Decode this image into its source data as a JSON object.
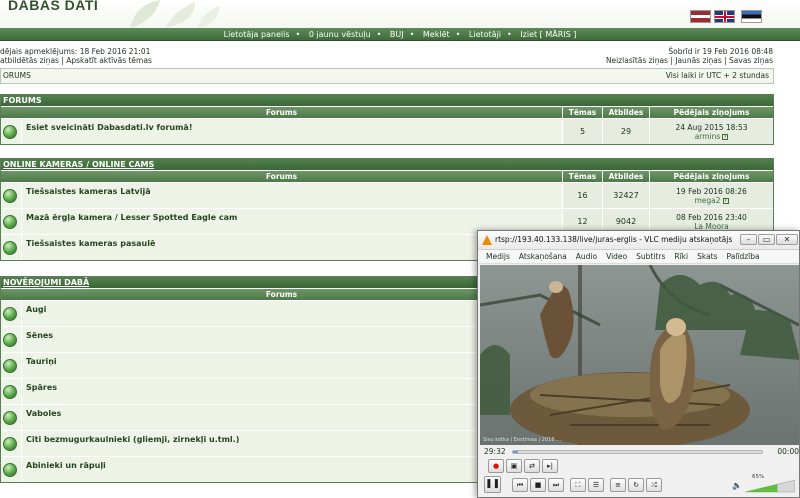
{
  "site": {
    "logo": "DABAS DATI"
  },
  "navbar": {
    "items": [
      "Lietotāja panelis",
      "0 jaunu vēstuļu",
      "BUJ",
      "Meklēt",
      "Lietotāji",
      "Iziet [ MĀRIS ]"
    ],
    "sep": "•"
  },
  "info": {
    "last_visit": "dējais apmeklējums: 18 Feb 2016 21:01",
    "left_links": "atbildētās ziņas | Apskatīt aktīvās tēmas",
    "today": "Šobrīd ir 19 Feb 2016 08:48",
    "right_links": "Neizlasītās ziņas | Jaunās ziņas | Savas ziņas"
  },
  "crumb": {
    "left": "ORUMS",
    "right": "Visi laiki ir UTC + 2 stundas"
  },
  "columns": {
    "forum": "Forums",
    "topics": "Tēmas",
    "posts": "Atbildes",
    "last_post": "Pēdējais ziņojums"
  },
  "sections": [
    {
      "title": "FORUMS",
      "rows": [
        {
          "name": "Esiet sveicināti Dabasdati.lv forumā!",
          "topics": "5",
          "posts": "29",
          "date": "24 Aug 2015 18:53",
          "user": "armins"
        }
      ]
    },
    {
      "title": "ONLINE KAMERAS / ONLINE CAMS",
      "rows": [
        {
          "name": "Tiešsaistes kameras Latvijā",
          "topics": "16",
          "posts": "32427",
          "date": "19 Feb 2016 08:26",
          "user": "mega2"
        },
        {
          "name": "Mazā ērgļa kamera / Lesser Spotted Eagle cam",
          "topics": "12",
          "posts": "9042",
          "date": "08 Feb 2016 23:40",
          "user": "La Moora"
        },
        {
          "name": "Tiešsaistes kameras pasaulē",
          "topics": "",
          "posts": "",
          "date": "",
          "user": ""
        }
      ]
    },
    {
      "title": "NOVĒROJUMI DABĀ",
      "rows": [
        {
          "name": "Augi"
        },
        {
          "name": "Sēnes"
        },
        {
          "name": "Tauriņi"
        },
        {
          "name": "Spāres"
        },
        {
          "name": "Vaboles"
        },
        {
          "name": "Citi bezmugurkaulnieki (gliemji, zirnekļi u.tml.)"
        },
        {
          "name": "Abinieki un rāpuļi"
        }
      ]
    }
  ],
  "vlc": {
    "title": "rtsp://193.40.133.138/live/juras-erglis - VLC mediju atskaņotājs",
    "menu": [
      "Medijs",
      "Atskaņošana",
      "Audio",
      "Video",
      "Subtitrs",
      "Rīki",
      "Skats",
      "Palīdzība"
    ],
    "elapsed": "29:32",
    "total": "00:00",
    "seek_fraction": 0.02,
    "volume_label": "65%",
    "volume_fraction": 0.65,
    "overlay": "Sivu kotka | Eestimaa | 2016 …",
    "window_buttons": {
      "min": "–",
      "max": "▭",
      "close": "✕"
    },
    "icons": [
      "record-icon",
      "snapshot-icon",
      "loop-ab-icon",
      "frame-step-icon",
      "pause-icon",
      "prev-icon",
      "stop-icon",
      "next-icon",
      "fullscreen-icon",
      "extended-settings-icon",
      "playlist-icon",
      "loop-icon",
      "shuffle-icon",
      "speaker-icon"
    ]
  },
  "colors": {
    "header_green": "#3f6b3b",
    "row_bg": "#eef3e8",
    "vlc_orange": "#f08a00"
  }
}
